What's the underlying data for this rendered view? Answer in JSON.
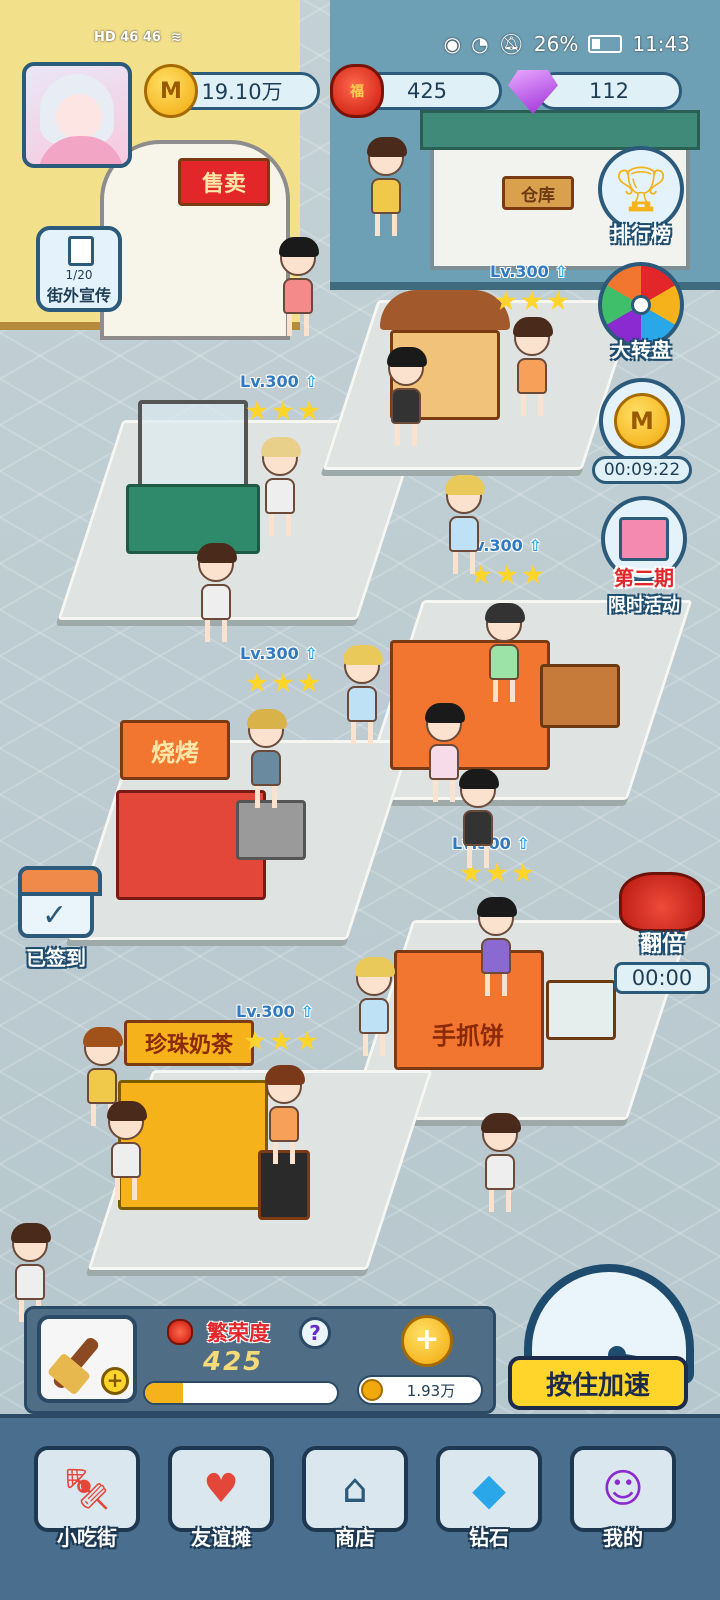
{
  "status": {
    "left_text": "HD 46 46",
    "battery": "26%",
    "time": "11:43"
  },
  "resources": {
    "coins": "19.10万",
    "lanterns": "425",
    "gems": "112"
  },
  "street_promo": {
    "count": "1/20",
    "label": "街外宣传"
  },
  "buildings": {
    "shop_sign": "售卖",
    "warehouse": "仓库"
  },
  "side_buttons": {
    "leaderboard": "排行榜",
    "wheel": "大转盘",
    "coin_timer": "00:09:22",
    "event_line1": "第二期",
    "event_line2": "限时活动",
    "double_label": "翻倍",
    "double_timer": "00:00",
    "signin_label": "已签到"
  },
  "stalls": [
    {
      "level": "Lv.300",
      "stars": 3
    },
    {
      "level": "Lv.300",
      "stars": 3
    },
    {
      "level": "Lv.300",
      "stars": 3
    },
    {
      "level": "Lv.300",
      "stars": 3
    },
    {
      "level": "Lv.300",
      "stars": 3
    },
    {
      "level": "Lv.300",
      "stars": 3
    }
  ],
  "stall_signs": {
    "skewer": "烧烤",
    "pancake": "手抓饼",
    "milktea": "珍珠奶茶"
  },
  "panel": {
    "prosperity_label": "繁荣度",
    "prosperity_value": "425",
    "prosperity_progress": 0.2,
    "earnings": "1.93万",
    "help": "?",
    "coin_plus": "+"
  },
  "speed_button": "按住加速",
  "nav": [
    {
      "label": "小吃街",
      "icon": "skewer-icon"
    },
    {
      "label": "友谊摊",
      "icon": "heart-shop-icon"
    },
    {
      "label": "商店",
      "icon": "store-icon"
    },
    {
      "label": "钻石",
      "icon": "diamond-icon"
    },
    {
      "label": "我的",
      "icon": "profile-icon"
    }
  ],
  "colors": {
    "accent_dark": "#2b5a7a",
    "gold": "#ffd42b",
    "red": "#e3262a",
    "floor": "#c3d1d6"
  }
}
